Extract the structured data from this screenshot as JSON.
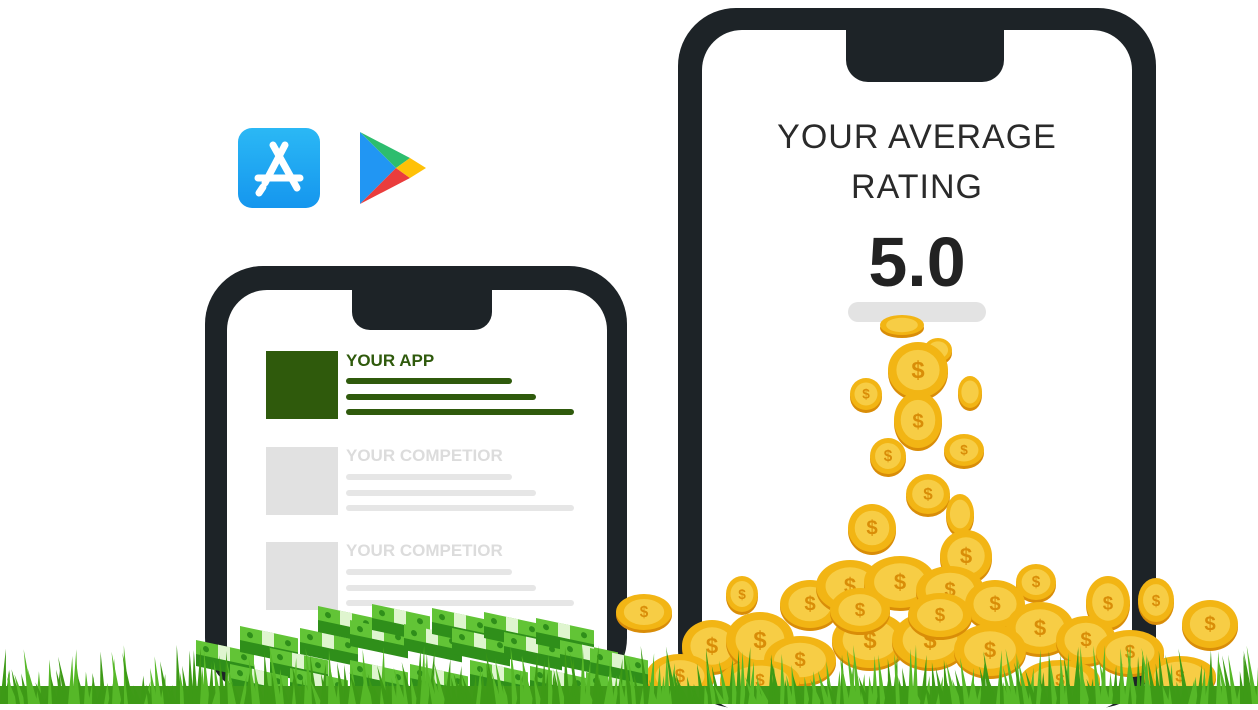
{
  "icons": {
    "app_store": "app-store-icon",
    "play_store": "google-play-icon"
  },
  "rating_phone": {
    "title_line1": "YOUR AVERAGE",
    "title_line2": "RATING",
    "value": "5.0"
  },
  "ranking_phone": {
    "rows": [
      {
        "label": "YOUR APP"
      },
      {
        "label": "YOUR COMPETIOR"
      },
      {
        "label": "YOUR COMPETIOR"
      }
    ]
  },
  "colors": {
    "phone_frame": "#1d2327",
    "app_green": "#2f5a0c",
    "competitor_gray": "#e1e1e1",
    "coin_gold": "#f2b514",
    "cash_green": "#56b82f",
    "grass_green": "#4caf1e"
  }
}
